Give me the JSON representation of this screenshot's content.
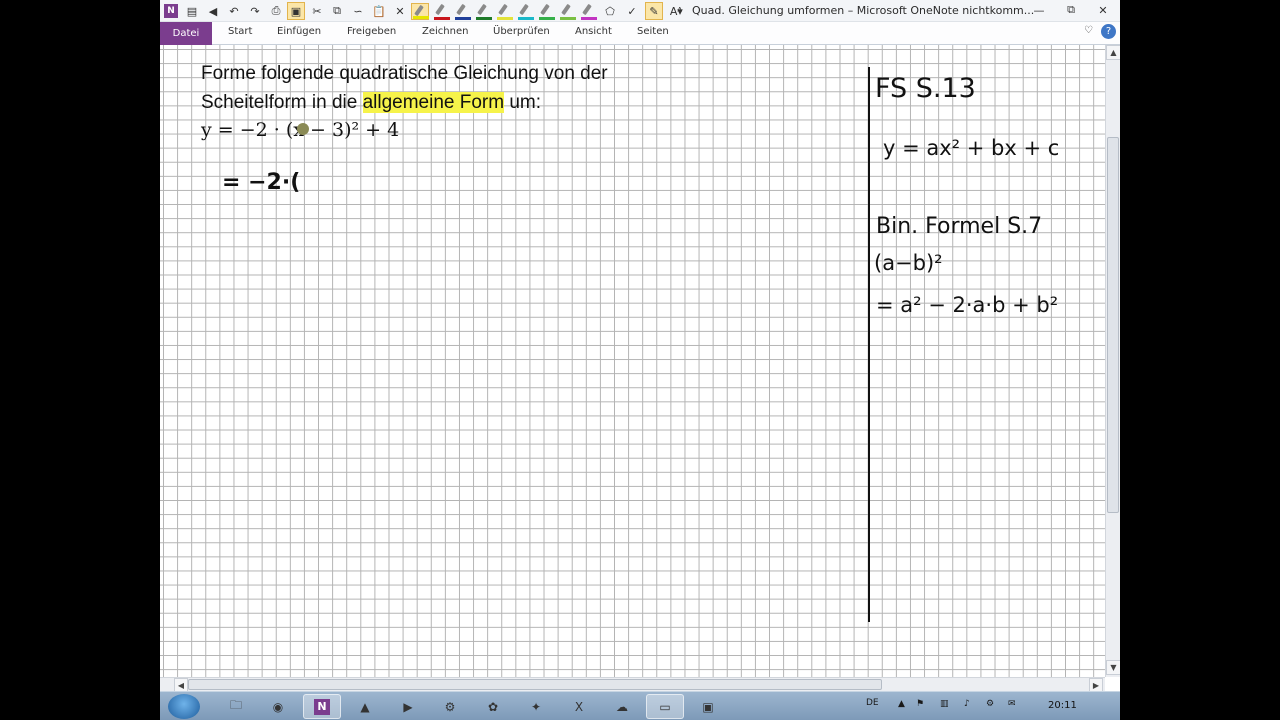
{
  "window": {
    "title": "Quad. Gleichung umformen – Microsoft OneNote nichtkomm...",
    "controls": [
      "—",
      "⧉",
      "✕"
    ]
  },
  "qat": {
    "icons": [
      "onenote-icon",
      "notebook-icon",
      "back-icon",
      "undo-icon",
      "redo-icon",
      "page-view-icon",
      "full-page-icon",
      "cut-icon",
      "copy-icon",
      "lasso-icon",
      "paste-icon",
      "eraser-icon"
    ],
    "pen_colors": [
      "#e7e600",
      "#c8161d",
      "#1f3f9a",
      "#1e7a2a",
      "#e2e23a",
      "#1bb8c9",
      "#35b04a",
      "#7ac043",
      "#c235c2"
    ]
  },
  "ribbon": {
    "file_tab": "Datei",
    "tabs": [
      "Start",
      "Einfügen",
      "Freigeben",
      "Zeichnen",
      "Überprüfen",
      "Ansicht",
      "Seiten"
    ]
  },
  "page": {
    "instruction_line1": "Forme folgende quadratische Gleichung von der",
    "instruction_line2_pre": "Scheitelform in die",
    "instruction_highlight": "allgemeine Form",
    "instruction_line2_post": "um:",
    "highlight_color": "#f6f34a",
    "equation": "y = −2 · (x − 3)² + 4",
    "handwritten_step": "= −2·(",
    "side_notes": {
      "ref1": "FS  S.13",
      "general_form": "y = ax² + bx + c",
      "ref2": "Bin. Formel  S.7",
      "binomial": "(a−b)²",
      "expansion": "= a² − 2·a·b + b²"
    }
  },
  "taskbar": {
    "keyboard_language": "DE",
    "clock": "20:11"
  }
}
